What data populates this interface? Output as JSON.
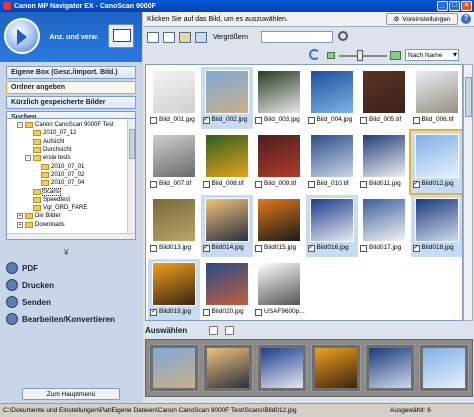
{
  "window": {
    "title": "Canon MP Navigator EX - CanoScan 9000F"
  },
  "sidebar": {
    "mode_label": "Anz. und verw.",
    "nav_items": [
      {
        "label": "Eigene Box (Gesc./import. Bild.)",
        "active": false
      },
      {
        "label": "Ordner angeben",
        "active": true
      },
      {
        "label": "Kürzlich gespeicherte Bilder",
        "active": false
      },
      {
        "label": "Suchen",
        "active": false
      }
    ],
    "tree": [
      {
        "label": "Canon CanoScan 9000F Test",
        "indent": 1,
        "toggle": "-"
      },
      {
        "label": "2010_07_12",
        "indent": 2,
        "toggle": ""
      },
      {
        "label": "Aufsicht",
        "indent": 2,
        "toggle": ""
      },
      {
        "label": "Durchsicht",
        "indent": 2,
        "toggle": ""
      },
      {
        "label": "erste tests",
        "indent": 2,
        "toggle": "-"
      },
      {
        "label": "2010_07_01",
        "indent": 3,
        "toggle": ""
      },
      {
        "label": "2010_07_02",
        "indent": 3,
        "toggle": ""
      },
      {
        "label": "2010_07_04",
        "indent": 3,
        "toggle": ""
      },
      {
        "label": "Scans",
        "indent": 2,
        "toggle": "",
        "selected": true
      },
      {
        "label": "Speedtest",
        "indent": 2,
        "toggle": ""
      },
      {
        "label": "Vgl_GRD_FARE",
        "indent": 2,
        "toggle": ""
      },
      {
        "label": "Div Bilder",
        "indent": 1,
        "toggle": "+"
      },
      {
        "label": "Downloads",
        "indent": 1,
        "toggle": "+"
      }
    ],
    "chevron": "¥",
    "actions": [
      {
        "label": "PDF"
      },
      {
        "label": "Drucken"
      },
      {
        "label": "Senden"
      },
      {
        "label": "Bearbeiten/Konvertieren"
      }
    ],
    "main_menu_button": "Zum Hauptmenü"
  },
  "main": {
    "instruction": "Klicken Sie auf das Bild, um es auszuwählen.",
    "preferences_button": "Voreinstellungen",
    "help_icon": "?",
    "zoom_label": "Vergrößern",
    "search_value": "",
    "sort_selected": "Nach Name",
    "thumbnails": [
      {
        "name": "Bild_001.jpg",
        "checked": false,
        "selected": false,
        "c1": "#f4f4f4",
        "c2": "#d0d0d0"
      },
      {
        "name": "Bild_002.jpg",
        "checked": true,
        "selected": true,
        "c1": "#7fa8d6",
        "c2": "#c9b08a"
      },
      {
        "name": "Bild_003.jpg",
        "checked": false,
        "selected": false,
        "c1": "#2a3d22",
        "c2": "#e6e6e6"
      },
      {
        "name": "Bild_004.jpg",
        "checked": false,
        "selected": false,
        "c1": "#1d4f9a",
        "c2": "#7eb3e8"
      },
      {
        "name": "Bild_005.tif",
        "checked": false,
        "selected": false,
        "c1": "#5a3326",
        "c2": "#3b221a"
      },
      {
        "name": "Bild_006.tif",
        "checked": false,
        "selected": false,
        "c1": "#e7eef7",
        "c2": "#9a8f7f"
      },
      {
        "name": "Bild_007.tif",
        "checked": false,
        "selected": false,
        "c1": "#cfcfcf",
        "c2": "#6a6a6a"
      },
      {
        "name": "Bild_008.tif",
        "checked": false,
        "selected": false,
        "c1": "#2f5f1f",
        "c2": "#e8a21a"
      },
      {
        "name": "Bild_009.tif",
        "checked": false,
        "selected": false,
        "c1": "#4a1f1f",
        "c2": "#b23b2a"
      },
      {
        "name": "Bild_010.tif",
        "checked": false,
        "selected": false,
        "c1": "#2c4d88",
        "c2": "#cbd6e8"
      },
      {
        "name": "Bild011.jpg",
        "checked": false,
        "selected": false,
        "c1": "#1e3f79",
        "c2": "#f0f0f0"
      },
      {
        "name": "Bild012.jpg",
        "checked": true,
        "selected": true,
        "focus": true,
        "c1": "#7fb0e6",
        "c2": "#e8f0fa"
      },
      {
        "name": "Bild013.jpg",
        "checked": false,
        "selected": false,
        "c1": "#7a6a3a",
        "c2": "#b8a56a"
      },
      {
        "name": "Bild014.jpg",
        "checked": true,
        "selected": true,
        "c1": "#f0c27a",
        "c2": "#2a3040"
      },
      {
        "name": "Bild015.jpg",
        "checked": false,
        "selected": false,
        "c1": "#e07a1a",
        "c2": "#1a1a1a"
      },
      {
        "name": "Bild016.jpg",
        "checked": true,
        "selected": true,
        "c1": "#1a3d8c",
        "c2": "#e8e8f2"
      },
      {
        "name": "Bild017.jpg",
        "checked": false,
        "selected": false,
        "c1": "#3a5f99",
        "c2": "#f4f4f4"
      },
      {
        "name": "Bild018.jpg",
        "checked": true,
        "selected": true,
        "c1": "#1a3a7a",
        "c2": "#cfd9ec"
      },
      {
        "name": "Bild019.jpg",
        "checked": true,
        "selected": true,
        "c1": "#f0a020",
        "c2": "#3a2410"
      },
      {
        "name": "Bild020.jpg",
        "checked": false,
        "selected": false,
        "c1": "#2a4a8a",
        "c2": "#c0603a"
      },
      {
        "name": "USAF9600p...",
        "checked": false,
        "selected": false,
        "c1": "#ffffff",
        "c2": "#555555"
      }
    ],
    "select_label": "Auswählen",
    "tray": [
      {
        "c1": "#7fa8d6",
        "c2": "#c9b08a"
      },
      {
        "c1": "#f0c27a",
        "c2": "#2a3040"
      },
      {
        "c1": "#1a3d8c",
        "c2": "#e8e8f2"
      },
      {
        "c1": "#f0a020",
        "c2": "#3a2410"
      },
      {
        "c1": "#1a3a7a",
        "c2": "#cfd9ec"
      },
      {
        "c1": "#7fb0e6",
        "c2": "#e8f0fa"
      }
    ]
  },
  "status": {
    "path": "C:\\Dokumente und Einstellungen\\Pat\\Eigene Dateien\\Canon CanoScan 9000F Test\\Scans\\Bild012.jpg",
    "count": "Ausgewählt: 6"
  }
}
